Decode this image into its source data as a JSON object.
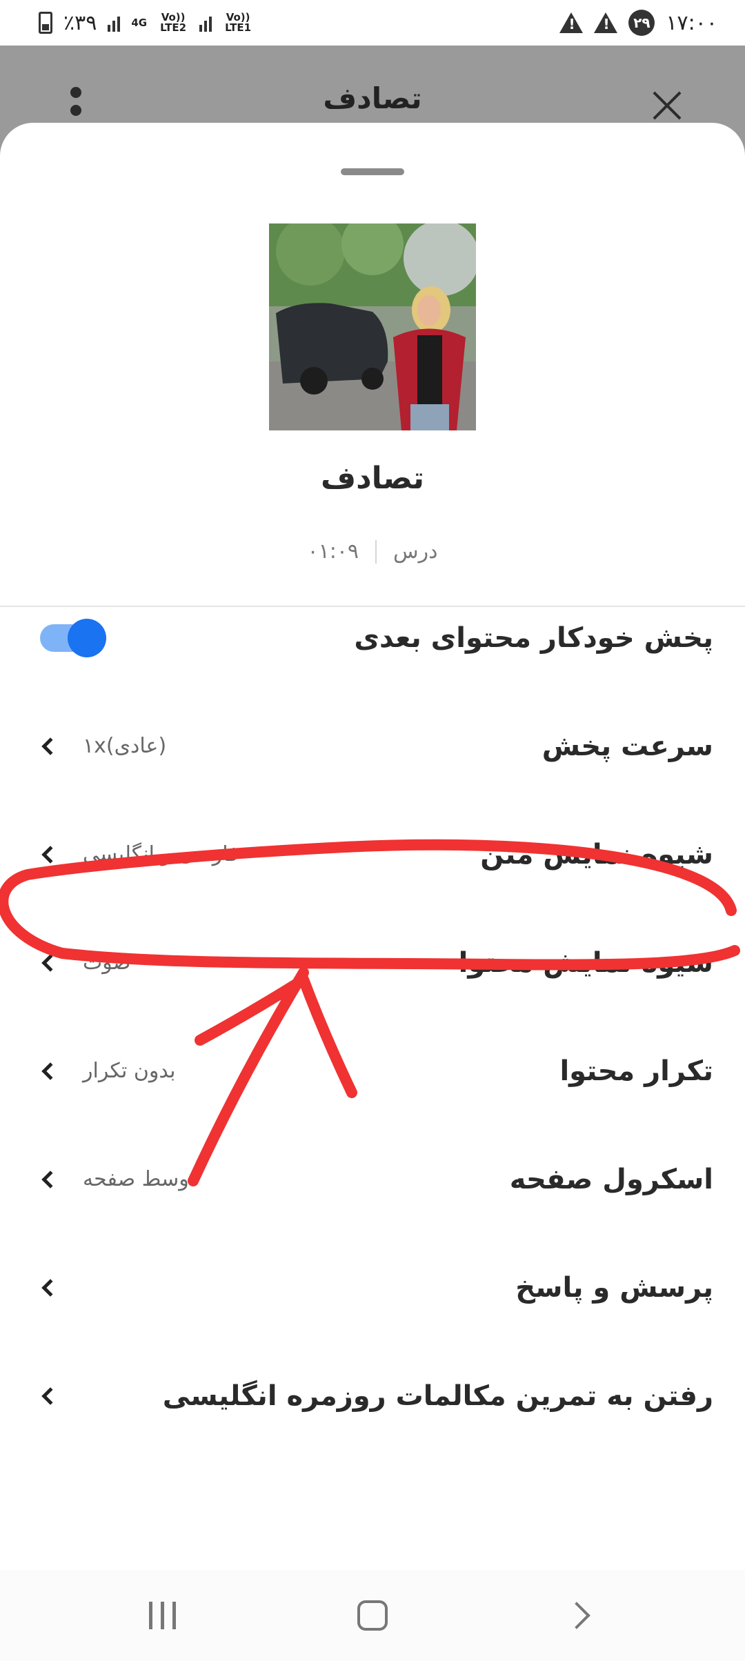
{
  "status_bar": {
    "battery": "٪۳۹",
    "net1": "4G",
    "net2": "Vo)) LTE2",
    "net3": "Vo)) LTE1",
    "date_badge": "۲۹",
    "time": "۱۷:۰۰",
    "icons": [
      "battery-icon",
      "signal-icon",
      "warning-icon",
      "warning-icon"
    ]
  },
  "header": {
    "title": "تصادف",
    "icons": [
      "more-vert-icon",
      "close-icon"
    ]
  },
  "lesson": {
    "image_alt": "car accident photo",
    "title": "تصادف",
    "type": "درس",
    "duration": "۰۱:۰۹"
  },
  "settings": [
    {
      "label": "پخش خودکار محتوای بعدی",
      "value": "",
      "control": "toggle",
      "on": true
    },
    {
      "label": "سرعت پخش",
      "value": "(عادی)۱x",
      "control": "chevron"
    },
    {
      "label": "شیوه نمایش متن",
      "value": "فارسی و انگلیسی",
      "control": "chevron"
    },
    {
      "label": "شیوه نمایش محتوا",
      "value": "صوت",
      "control": "chevron"
    },
    {
      "label": "تکرار محتوا",
      "value": "بدون تکرار",
      "control": "chevron"
    },
    {
      "label": "اسکرول صفحه",
      "value": "وسط صفحه",
      "control": "chevron"
    },
    {
      "label": "پرسش و پاسخ",
      "value": "",
      "control": "chevron"
    },
    {
      "label": "رفتن به تمرین مکالمات روزمره انگلیسی",
      "value": "",
      "control": "chevron"
    }
  ],
  "colors": {
    "toggle_on": "#1a73f0",
    "toggle_track": "#7fb3f7",
    "annotation": "#f03232"
  },
  "nav": {
    "icons": [
      "recents-icon",
      "home-icon",
      "back-icon"
    ]
  }
}
